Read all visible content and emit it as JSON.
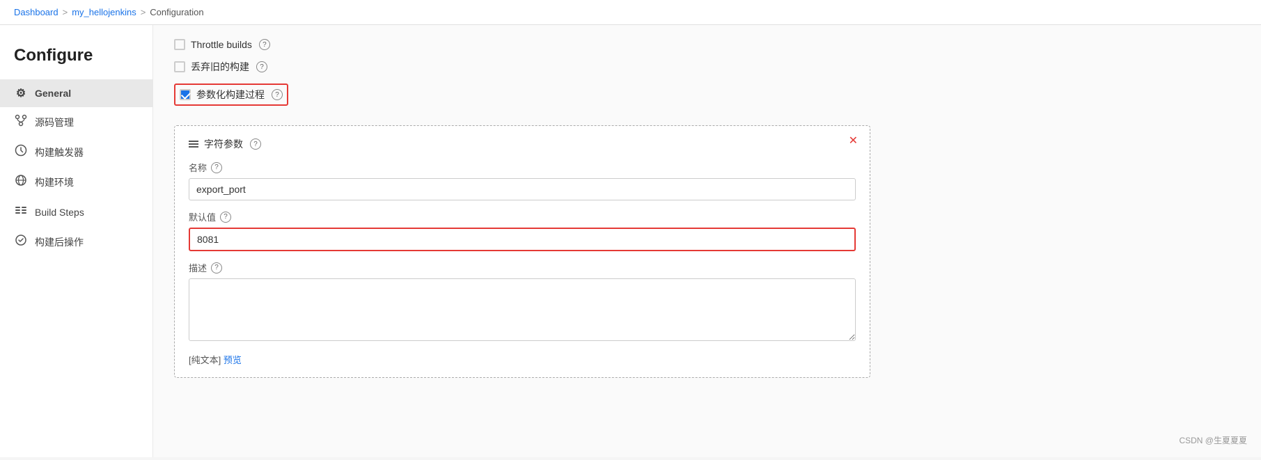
{
  "breadcrumb": {
    "items": [
      "Dashboard",
      "my_hellojenkins",
      "Configuration"
    ],
    "separators": [
      ">",
      ">"
    ]
  },
  "sidebar": {
    "title": "Configure",
    "items": [
      {
        "id": "general",
        "label": "General",
        "icon": "⚙",
        "active": true
      },
      {
        "id": "source-mgmt",
        "label": "源码管理",
        "icon": "⑂"
      },
      {
        "id": "triggers",
        "label": "构建触发器",
        "icon": "⏱"
      },
      {
        "id": "env",
        "label": "构建环境",
        "icon": "🌐"
      },
      {
        "id": "build-steps",
        "label": "Build Steps",
        "icon": "≡"
      },
      {
        "id": "post-build",
        "label": "构建后操作",
        "icon": "⚙"
      }
    ]
  },
  "main": {
    "checkboxes": [
      {
        "id": "throttle",
        "label": "Throttle builds",
        "checked": false
      },
      {
        "id": "discard",
        "label": "丢弃旧的构建",
        "checked": false
      },
      {
        "id": "parameterize",
        "label": "参数化构建过程",
        "checked": true,
        "highlighted": true
      }
    ],
    "help_icon": "?",
    "param_section": {
      "header": "字符参数",
      "name_label": "名称",
      "name_help": "?",
      "name_value": "export_port",
      "default_label": "默认值",
      "default_help": "?",
      "default_value": "8081",
      "description_label": "描述",
      "description_help": "?",
      "description_value": "",
      "footer_prefix": "[纯文本]",
      "footer_preview": "预览"
    }
  },
  "watermark": "CSDN @生夏夏夏"
}
